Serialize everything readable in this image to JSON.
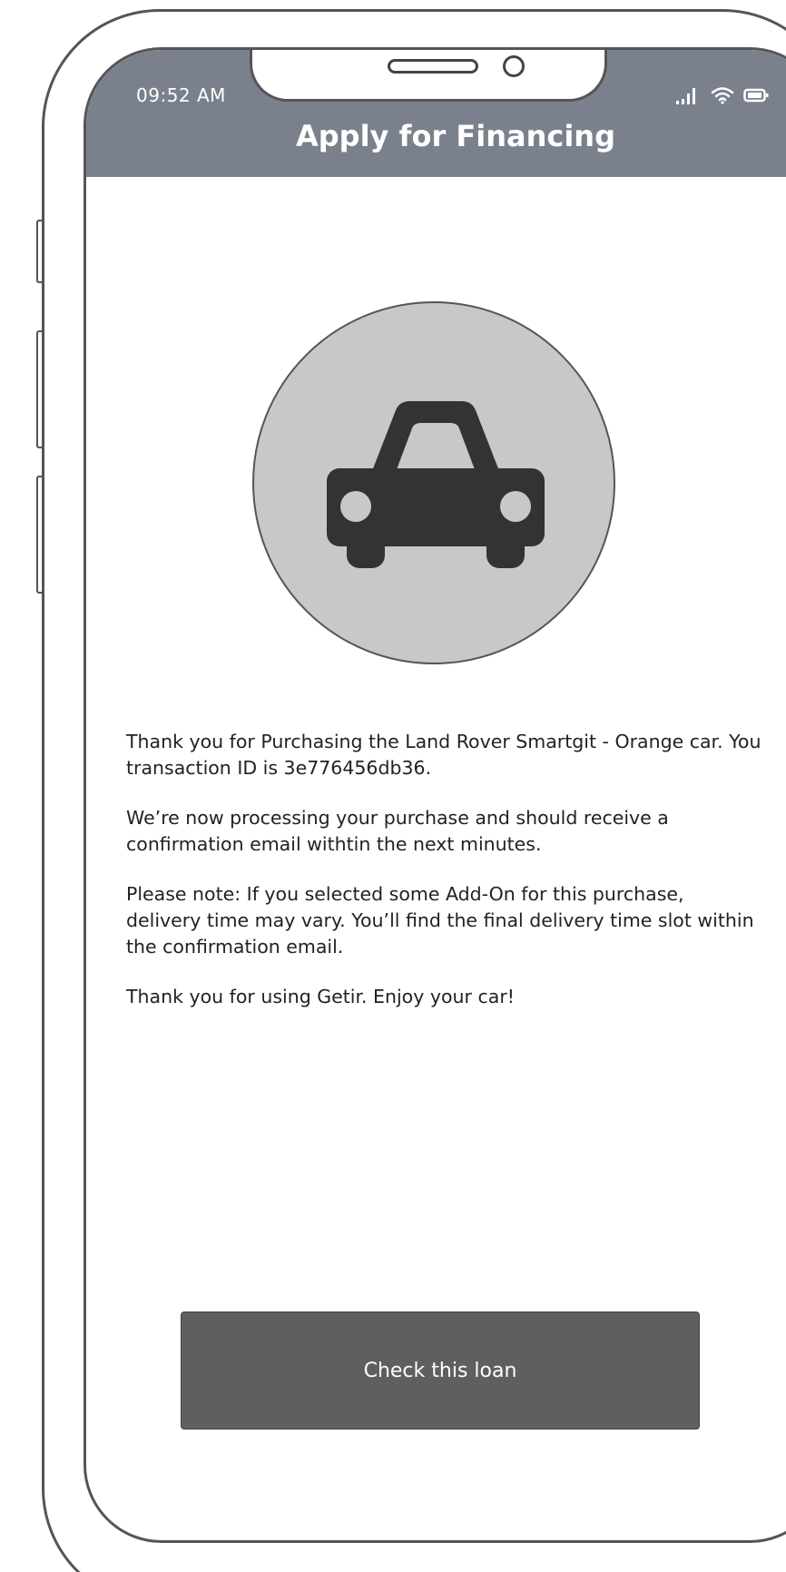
{
  "status_bar": {
    "time": "09:52 AM",
    "icons": [
      "signal-icon",
      "wifi-icon",
      "battery-icon"
    ]
  },
  "header": {
    "title": "Apply for Financing"
  },
  "hero": {
    "icon": "car-icon"
  },
  "message": {
    "paragraphs": [
      "Thank you for Purchasing the Land Rover Smartgit - Orange car. You transaction ID is 3e776456db36.",
      "We’re now processing your purchase and should receive a confirmation email withtin the next minutes.",
      "Please note: If you selected some Add-On for this purchase, delivery time may vary. You’ll find the final delivery time slot within the confirmation email.",
      "Thank you for using Getir. Enjoy your car!"
    ]
  },
  "cta": {
    "label": "Check this loan"
  },
  "colors": {
    "header_bg": "#7a818c",
    "button_bg": "#5f5f5f",
    "circle_bg": "#c8c8c8",
    "icon_fg": "#333333"
  }
}
